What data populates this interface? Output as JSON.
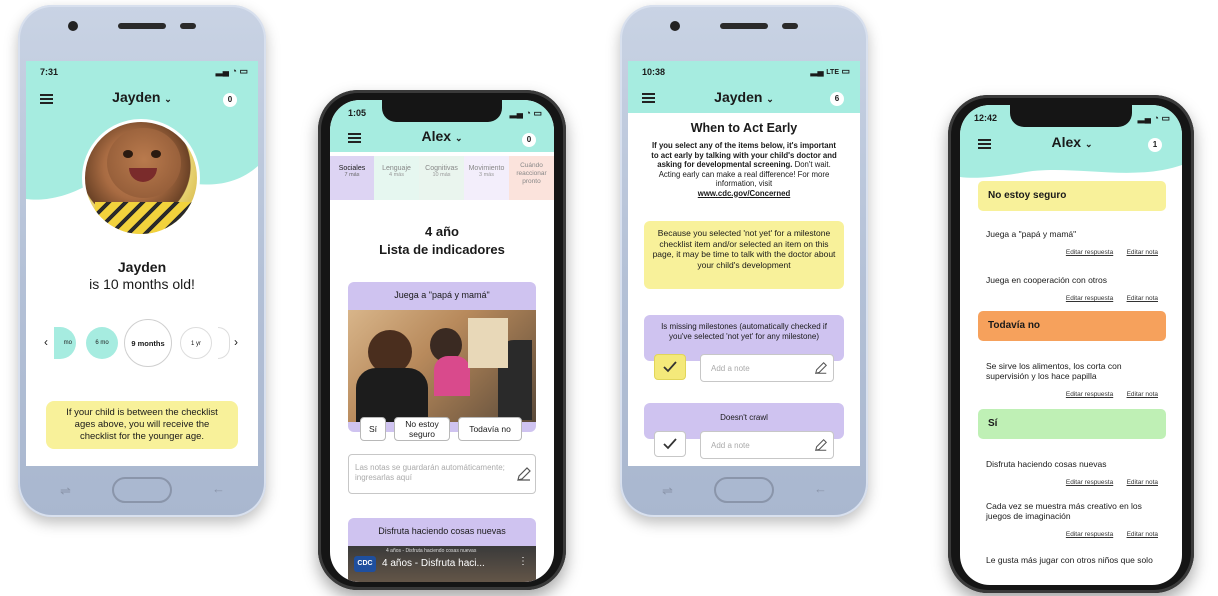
{
  "phone1": {
    "time": "7:31",
    "child_name": "Jayden",
    "badge_count": "0",
    "name_line": "Jayden",
    "age_line": "is 10 months old!",
    "age_selector": {
      "partial_left": "mo",
      "prev": "6 mo",
      "selected": "9 months",
      "next": "1 yr"
    },
    "info_text": "If your child is between the checklist ages above, you will receive the checklist for the younger age."
  },
  "phone2": {
    "time": "1:05",
    "child_name": "Alex",
    "badge_count": "0",
    "tabs": [
      {
        "label": "Sociales",
        "sub": "7 más"
      },
      {
        "label": "Lenguaje",
        "sub": "4 más"
      },
      {
        "label": "Cognitivas",
        "sub": "10 más"
      },
      {
        "label": "Movimiento",
        "sub": "3 más"
      },
      {
        "label": "Cuándo reaccionar pronto",
        "sub": ""
      }
    ],
    "heading_age": "4 año",
    "heading_list": "Lista de indicadores",
    "card1_title": "Juega a \"papá y mamá\"",
    "answers": {
      "yes": "Sí",
      "unsure": "No estoy seguro",
      "not_yet": "Todavía no"
    },
    "notes_placeholder": "Las notas se guardarán automáticamente; ingresarlas aquí",
    "card2_title": "Disfruta haciendo cosas nuevas",
    "video_small": "4 años - Disfruta haciendo cosas nuevas",
    "video_logo": "CDC",
    "video_title": "4 años - Disfruta haci..."
  },
  "phone3": {
    "time": "10:38",
    "network": "LTE",
    "child_name": "Jayden",
    "badge_count": "6",
    "title": "When to Act Early",
    "intro_bold": "If you select any of the items below, it's important to act early by talking with your child's doctor and asking for developmental screening.",
    "intro_rest": "Don't wait. Acting early can make a real difference! For more information, visit",
    "link": "www.cdc.gov/Concerned",
    "notice": "Because you selected 'not yet' for a milestone checklist item and/or selected an item on this page, it may be time to talk with the doctor about your child's development",
    "item1": "Is missing milestones (automatically checked if you've selected 'not yet' for any milestone)",
    "item2": "Doesn't crawl",
    "note_placeholder": "Add a note"
  },
  "phone4": {
    "time": "12:42",
    "child_name": "Alex",
    "badge_count": "1",
    "edit_answer": "Editar respuesta",
    "edit_note": "Editar nota",
    "sections": [
      {
        "title": "No estoy seguro",
        "items": [
          "Juega a \"papá y mamá\"",
          "Juega en cooperación con otros"
        ]
      },
      {
        "title": "Todavía no",
        "items": [
          "Se sirve los alimentos, los corta con supervisión y los hace papilla"
        ]
      },
      {
        "title": "Sí",
        "items": [
          "Disfruta haciendo cosas nuevas",
          "Cada vez se muestra más creativo en los juegos de imaginación",
          "Le gusta más jugar con otros niños que solo"
        ]
      }
    ]
  },
  "colors": {
    "teal": "#a6ece0",
    "yellow": "#f8f19a",
    "purple": "#cfc3f0",
    "orange": "#f6a15c",
    "green": "#bff0b5"
  }
}
